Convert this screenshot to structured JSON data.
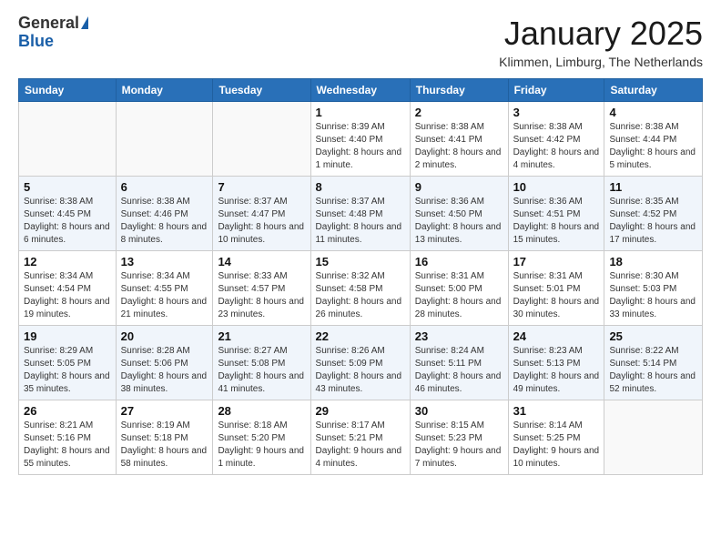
{
  "header": {
    "logo_general": "General",
    "logo_blue": "Blue",
    "month_title": "January 2025",
    "location": "Klimmen, Limburg, The Netherlands"
  },
  "weekdays": [
    "Sunday",
    "Monday",
    "Tuesday",
    "Wednesday",
    "Thursday",
    "Friday",
    "Saturday"
  ],
  "weeks": [
    [
      {
        "day": "",
        "info": ""
      },
      {
        "day": "",
        "info": ""
      },
      {
        "day": "",
        "info": ""
      },
      {
        "day": "1",
        "info": "Sunrise: 8:39 AM\nSunset: 4:40 PM\nDaylight: 8 hours and 1 minute."
      },
      {
        "day": "2",
        "info": "Sunrise: 8:38 AM\nSunset: 4:41 PM\nDaylight: 8 hours and 2 minutes."
      },
      {
        "day": "3",
        "info": "Sunrise: 8:38 AM\nSunset: 4:42 PM\nDaylight: 8 hours and 4 minutes."
      },
      {
        "day": "4",
        "info": "Sunrise: 8:38 AM\nSunset: 4:44 PM\nDaylight: 8 hours and 5 minutes."
      }
    ],
    [
      {
        "day": "5",
        "info": "Sunrise: 8:38 AM\nSunset: 4:45 PM\nDaylight: 8 hours and 6 minutes."
      },
      {
        "day": "6",
        "info": "Sunrise: 8:38 AM\nSunset: 4:46 PM\nDaylight: 8 hours and 8 minutes."
      },
      {
        "day": "7",
        "info": "Sunrise: 8:37 AM\nSunset: 4:47 PM\nDaylight: 8 hours and 10 minutes."
      },
      {
        "day": "8",
        "info": "Sunrise: 8:37 AM\nSunset: 4:48 PM\nDaylight: 8 hours and 11 minutes."
      },
      {
        "day": "9",
        "info": "Sunrise: 8:36 AM\nSunset: 4:50 PM\nDaylight: 8 hours and 13 minutes."
      },
      {
        "day": "10",
        "info": "Sunrise: 8:36 AM\nSunset: 4:51 PM\nDaylight: 8 hours and 15 minutes."
      },
      {
        "day": "11",
        "info": "Sunrise: 8:35 AM\nSunset: 4:52 PM\nDaylight: 8 hours and 17 minutes."
      }
    ],
    [
      {
        "day": "12",
        "info": "Sunrise: 8:34 AM\nSunset: 4:54 PM\nDaylight: 8 hours and 19 minutes."
      },
      {
        "day": "13",
        "info": "Sunrise: 8:34 AM\nSunset: 4:55 PM\nDaylight: 8 hours and 21 minutes."
      },
      {
        "day": "14",
        "info": "Sunrise: 8:33 AM\nSunset: 4:57 PM\nDaylight: 8 hours and 23 minutes."
      },
      {
        "day": "15",
        "info": "Sunrise: 8:32 AM\nSunset: 4:58 PM\nDaylight: 8 hours and 26 minutes."
      },
      {
        "day": "16",
        "info": "Sunrise: 8:31 AM\nSunset: 5:00 PM\nDaylight: 8 hours and 28 minutes."
      },
      {
        "day": "17",
        "info": "Sunrise: 8:31 AM\nSunset: 5:01 PM\nDaylight: 8 hours and 30 minutes."
      },
      {
        "day": "18",
        "info": "Sunrise: 8:30 AM\nSunset: 5:03 PM\nDaylight: 8 hours and 33 minutes."
      }
    ],
    [
      {
        "day": "19",
        "info": "Sunrise: 8:29 AM\nSunset: 5:05 PM\nDaylight: 8 hours and 35 minutes."
      },
      {
        "day": "20",
        "info": "Sunrise: 8:28 AM\nSunset: 5:06 PM\nDaylight: 8 hours and 38 minutes."
      },
      {
        "day": "21",
        "info": "Sunrise: 8:27 AM\nSunset: 5:08 PM\nDaylight: 8 hours and 41 minutes."
      },
      {
        "day": "22",
        "info": "Sunrise: 8:26 AM\nSunset: 5:09 PM\nDaylight: 8 hours and 43 minutes."
      },
      {
        "day": "23",
        "info": "Sunrise: 8:24 AM\nSunset: 5:11 PM\nDaylight: 8 hours and 46 minutes."
      },
      {
        "day": "24",
        "info": "Sunrise: 8:23 AM\nSunset: 5:13 PM\nDaylight: 8 hours and 49 minutes."
      },
      {
        "day": "25",
        "info": "Sunrise: 8:22 AM\nSunset: 5:14 PM\nDaylight: 8 hours and 52 minutes."
      }
    ],
    [
      {
        "day": "26",
        "info": "Sunrise: 8:21 AM\nSunset: 5:16 PM\nDaylight: 8 hours and 55 minutes."
      },
      {
        "day": "27",
        "info": "Sunrise: 8:19 AM\nSunset: 5:18 PM\nDaylight: 8 hours and 58 minutes."
      },
      {
        "day": "28",
        "info": "Sunrise: 8:18 AM\nSunset: 5:20 PM\nDaylight: 9 hours and 1 minute."
      },
      {
        "day": "29",
        "info": "Sunrise: 8:17 AM\nSunset: 5:21 PM\nDaylight: 9 hours and 4 minutes."
      },
      {
        "day": "30",
        "info": "Sunrise: 8:15 AM\nSunset: 5:23 PM\nDaylight: 9 hours and 7 minutes."
      },
      {
        "day": "31",
        "info": "Sunrise: 8:14 AM\nSunset: 5:25 PM\nDaylight: 9 hours and 10 minutes."
      },
      {
        "day": "",
        "info": ""
      }
    ]
  ]
}
